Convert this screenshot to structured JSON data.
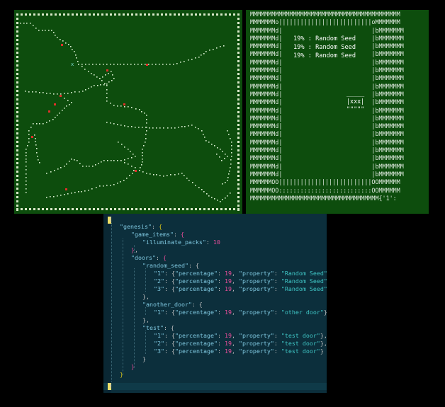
{
  "colors": {
    "screen_bg": "#0d4d0d",
    "editor_bg": "#0c2f3c",
    "key": "#7fc8e0",
    "string": "#3fc5c5",
    "number": "#e84d9a",
    "brace": "#d4c21a"
  },
  "door_screen": {
    "entries": [
      {
        "percent": "19%",
        "sep": ":",
        "label": "Random Seed"
      },
      {
        "percent": "19%",
        "sep": ":",
        "label": "Random Seed"
      },
      {
        "percent": "19%",
        "sep": ":",
        "label": "Random Seed"
      }
    ],
    "door_box_top": "_____",
    "door_box_mid": "|xxx|",
    "door_box_bottom": "\"\"\"\"\"",
    "tail_text": "{'1':"
  },
  "editor": {
    "root_key": "\"genesis\"",
    "game_items_key": "\"game_items\"",
    "illuminate_key": "\"illuminate_packs\"",
    "illuminate_value": "10",
    "doors_key": "\"doors\"",
    "random_seed_key": "\"random_seed\"",
    "another_door_key": "\"another_door\"",
    "test_key": "\"test\"",
    "percentage_key": "\"percentage\"",
    "property_key": "\"property\"",
    "pct_value": "19",
    "random_seed_rows": [
      {
        "id": "\"1\"",
        "property": "\"Random Seed\""
      },
      {
        "id": "\"2\"",
        "property": "\"Random Seed\""
      },
      {
        "id": "\"3\"",
        "property": "\"Random Seed\""
      }
    ],
    "another_door_rows": [
      {
        "id": "\"1\"",
        "property": "\"other door\""
      }
    ],
    "test_rows": [
      {
        "id": "\"1\"",
        "property": "\"test door\""
      },
      {
        "id": "\"2\"",
        "property": "\"test door\""
      },
      {
        "id": "\"3\"",
        "property": "\"test door\""
      }
    ]
  }
}
